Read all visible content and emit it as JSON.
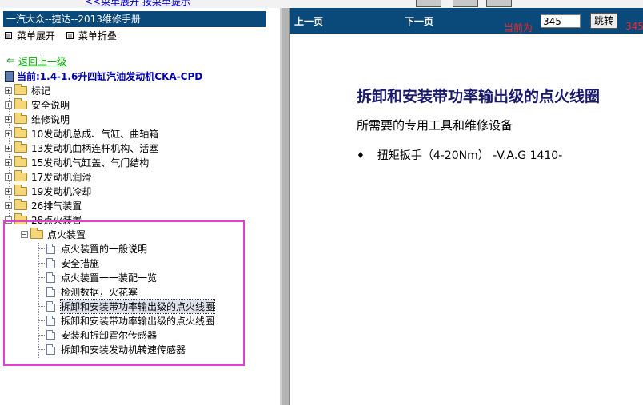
{
  "top_link": "<<菜单展开 按菜单提示",
  "left_panel": {
    "title": "一汽大众--捷达--2013维修手册",
    "menu": {
      "expand": "菜单展开",
      "collapse": "菜单折叠"
    },
    "back_link": "返回上一级",
    "current": "当前:1.4-1.6升四缸汽油发动机CKA-CPD",
    "tree": [
      {
        "label": "标记"
      },
      {
        "label": "安全说明"
      },
      {
        "label": "维修说明"
      },
      {
        "label": "10发动机总成、气缸、曲轴箱"
      },
      {
        "label": "13发动机曲柄连杆机构、活塞"
      },
      {
        "label": "15发动机气缸盖、气门结构"
      },
      {
        "label": "17发动机润滑"
      },
      {
        "label": "19发动机冷却"
      },
      {
        "label": "26排气装置"
      },
      {
        "label": "28点火装置"
      }
    ],
    "subfolder": "点火装置",
    "docs": [
      {
        "label": "点火装置的一般说明"
      },
      {
        "label": "安全措施"
      },
      {
        "label": "点火装置一一装配一览"
      },
      {
        "label": "检测数据，火花塞"
      },
      {
        "label": "拆卸和安装带功率输出级的点火线圈"
      },
      {
        "label": "拆卸和安装带功率输出级的点火线圈"
      },
      {
        "label": "安装和拆卸霍尔传感器"
      },
      {
        "label": "拆卸和安装发动机转速传感器"
      }
    ]
  },
  "nav": {
    "prev": "上一页",
    "next": "下一页",
    "current_label": "当前为",
    "page_value": "345",
    "go": "跳转",
    "current_num": "345"
  },
  "content": {
    "title": "拆卸和安装带功率输出级的点火线圈",
    "subtitle": "所需要的专用工具和维修设备",
    "bullet_icon": "♦",
    "tools": [
      "扭矩扳手（4-20Nm） -V.A.G 1410-"
    ]
  },
  "colors": {
    "header_bg": "#0a4a7a",
    "highlight_border": "#e040d0",
    "accent_red": "#ff2020"
  }
}
